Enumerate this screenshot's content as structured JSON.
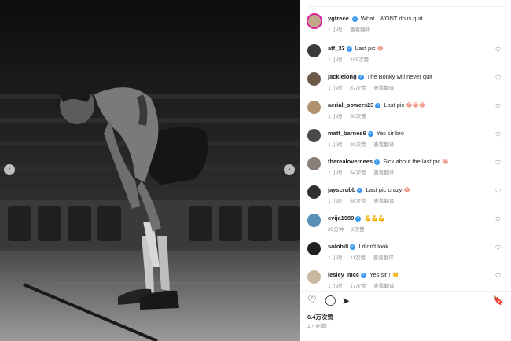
{
  "photo": {
    "alt": ""
  },
  "carousel": {
    "prev_icon": "‹",
    "next_icon": "›"
  },
  "caption": {
    "user": "ygtrece",
    "text": "What I WONT do is quit",
    "time": "1 小时",
    "translate": "查看翻译"
  },
  "comments": [
    {
      "user": "atf_33",
      "text": "Last pic",
      "emoji": "😂",
      "time": "1 小时",
      "likes": "109次赞",
      "translate": ""
    },
    {
      "user": "jackielong",
      "text": "The Bonky will never quit",
      "emoji": "",
      "time": "1 小时",
      "likes": "87次赞",
      "translate": "查看翻译"
    },
    {
      "user": "aerial_powers23",
      "text": "Last pic",
      "emoji": "😂😂😂",
      "time": "1 小时",
      "likes": "30次赞",
      "translate": ""
    },
    {
      "user": "matt_barnes9",
      "text": "Yes sir bro",
      "emoji": "",
      "time": "1 小时",
      "likes": "91次赞",
      "translate": "查看翻译"
    },
    {
      "user": "therealovercees",
      "text": "Sick about the last pic",
      "emoji": "😂",
      "time": "1 小时",
      "likes": "64次赞",
      "translate": "查看翻译"
    },
    {
      "user": "jayscrubb",
      "text": "Last pic crazy",
      "emoji": "😂",
      "time": "1 小时",
      "likes": "65次赞",
      "translate": "查看翻译"
    },
    {
      "user": "cvija1989",
      "text": "",
      "emoji": "💪💪💪",
      "time": "39分钟",
      "likes": "2次赞",
      "translate": ""
    },
    {
      "user": "solohill",
      "text": "I didn't look.",
      "emoji": "",
      "time": "1 小时",
      "likes": "11次赞",
      "translate": "查看翻译"
    },
    {
      "user": "lesley_mcc",
      "text": "Yes sir!!",
      "emoji": "👏",
      "time": "1 小时",
      "likes": "17次赞",
      "translate": "查看翻译"
    }
  ],
  "actions": {
    "like_icon": "♡",
    "comment_icon": "◯",
    "share_icon": "➤",
    "save_icon": "🔖"
  },
  "post": {
    "likes": "6.4万次赞",
    "time": "1 小时前"
  },
  "colors": {
    "verified": "#3897f0",
    "ring": "#d6249f",
    "text": "#262626",
    "meta": "#8e8e8e"
  }
}
